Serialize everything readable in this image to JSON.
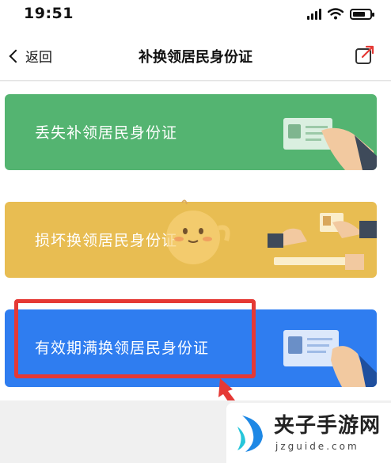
{
  "status_bar": {
    "time": "19:51",
    "battery_level": 0.75
  },
  "nav": {
    "back_label": "返回",
    "title": "补换领居民身份证"
  },
  "cards": [
    {
      "label": "丢失补领居民身份证",
      "color": "#54b471"
    },
    {
      "label": "损坏换领居民身份证",
      "color": "#e8bd52"
    },
    {
      "label": "有效期满换领居民身份证",
      "color": "#2f7df0"
    }
  ],
  "annotation": {
    "highlight_color": "#e53935"
  },
  "watermark": {
    "title": "夹子手游网",
    "url": "jzguide.com"
  },
  "icons": [
    "back-chevron-icon",
    "share-icon",
    "signal-icon",
    "wifi-icon",
    "battery-icon",
    "id-card-icon"
  ]
}
